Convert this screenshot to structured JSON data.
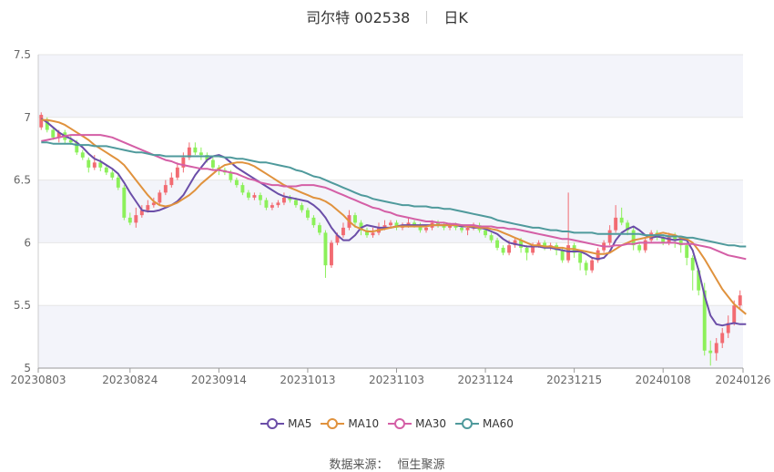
{
  "title": {
    "name": "司尔特 002538",
    "period": "日K"
  },
  "source": {
    "label": "数据来源：",
    "value": "恒生聚源"
  },
  "colors": {
    "up": "#f26b72",
    "down": "#8cf05a",
    "ma5": "#6b4ea8",
    "ma10": "#e0923d",
    "ma30": "#d45fa6",
    "ma60": "#4f9a9c",
    "band": "#f3f4fa",
    "grid": "#e6e6e6",
    "axis": "#666666"
  },
  "chart_data": {
    "type": "candlestick",
    "y_axis": {
      "min": 5,
      "max": 7.5,
      "ticks": [
        5,
        5.5,
        6,
        6.5,
        7,
        7.5
      ],
      "tick_labels": [
        "5",
        "5.5",
        "6",
        "6.5",
        "7",
        "7.5"
      ]
    },
    "x_axis": {
      "tick_labels": [
        "20230803",
        "20230824",
        "20230914",
        "20231013",
        "20231103",
        "20231124",
        "20231215",
        "20240108",
        "20240126"
      ],
      "tick_index": [
        0,
        15,
        30,
        45,
        60,
        75,
        90,
        105,
        119
      ]
    },
    "grid": true,
    "candles": [
      [
        6.92,
        7.02,
        7.04,
        6.9
      ],
      [
        6.98,
        6.9,
        7.0,
        6.88
      ],
      [
        6.9,
        6.84,
        6.92,
        6.82
      ],
      [
        6.84,
        6.88,
        6.9,
        6.8
      ],
      [
        6.88,
        6.82,
        6.9,
        6.79
      ],
      [
        6.82,
        6.8,
        6.86,
        6.78
      ],
      [
        6.8,
        6.72,
        6.82,
        6.7
      ],
      [
        6.72,
        6.68,
        6.74,
        6.66
      ],
      [
        6.66,
        6.6,
        6.68,
        6.56
      ],
      [
        6.6,
        6.64,
        6.7,
        6.58
      ],
      [
        6.64,
        6.6,
        6.67,
        6.57
      ],
      [
        6.6,
        6.56,
        6.62,
        6.54
      ],
      [
        6.56,
        6.52,
        6.58,
        6.5
      ],
      [
        6.52,
        6.44,
        6.54,
        6.42
      ],
      [
        6.44,
        6.2,
        6.46,
        6.18
      ],
      [
        6.2,
        6.16,
        6.24,
        6.14
      ],
      [
        6.16,
        6.22,
        6.28,
        6.12
      ],
      [
        6.22,
        6.26,
        6.3,
        6.2
      ],
      [
        6.26,
        6.3,
        6.34,
        6.24
      ],
      [
        6.3,
        6.32,
        6.36,
        6.28
      ],
      [
        6.32,
        6.4,
        6.42,
        6.3
      ],
      [
        6.4,
        6.46,
        6.5,
        6.38
      ],
      [
        6.46,
        6.52,
        6.56,
        6.44
      ],
      [
        6.52,
        6.6,
        6.64,
        6.5
      ],
      [
        6.6,
        6.68,
        6.72,
        6.56
      ],
      [
        6.68,
        6.76,
        6.8,
        6.66
      ],
      [
        6.76,
        6.72,
        6.8,
        6.7
      ],
      [
        6.72,
        6.7,
        6.76,
        6.66
      ],
      [
        6.7,
        6.66,
        6.72,
        6.64
      ],
      [
        6.66,
        6.6,
        6.68,
        6.58
      ],
      [
        6.6,
        6.58,
        6.62,
        6.54
      ],
      [
        6.58,
        6.56,
        6.6,
        6.54
      ],
      [
        6.56,
        6.5,
        6.58,
        6.48
      ],
      [
        6.5,
        6.46,
        6.52,
        6.44
      ],
      [
        6.46,
        6.4,
        6.48,
        6.38
      ],
      [
        6.4,
        6.36,
        6.42,
        6.34
      ],
      [
        6.36,
        6.38,
        6.4,
        6.34
      ],
      [
        6.38,
        6.34,
        6.4,
        6.3
      ],
      [
        6.34,
        6.28,
        6.36,
        6.26
      ],
      [
        6.28,
        6.3,
        6.32,
        6.26
      ],
      [
        6.3,
        6.32,
        6.34,
        6.28
      ],
      [
        6.32,
        6.36,
        6.4,
        6.3
      ],
      [
        6.36,
        6.34,
        6.38,
        6.32
      ],
      [
        6.34,
        6.3,
        6.36,
        6.28
      ],
      [
        6.3,
        6.26,
        6.32,
        6.24
      ],
      [
        6.26,
        6.2,
        6.28,
        6.18
      ],
      [
        6.2,
        6.14,
        6.22,
        6.12
      ],
      [
        6.14,
        6.08,
        6.16,
        6.06
      ],
      [
        6.08,
        5.82,
        6.1,
        5.72
      ],
      [
        5.82,
        6.0,
        6.02,
        5.8
      ],
      [
        6.0,
        6.06,
        6.08,
        5.98
      ],
      [
        6.06,
        6.12,
        6.16,
        6.04
      ],
      [
        6.12,
        6.22,
        6.26,
        6.1
      ],
      [
        6.22,
        6.16,
        6.24,
        6.12
      ],
      [
        6.16,
        6.1,
        6.18,
        6.06
      ],
      [
        6.1,
        6.06,
        6.12,
        6.04
      ],
      [
        6.06,
        6.08,
        6.12,
        6.04
      ],
      [
        6.08,
        6.12,
        6.16,
        6.06
      ],
      [
        6.12,
        6.14,
        6.18,
        6.1
      ],
      [
        6.14,
        6.16,
        6.18,
        6.12
      ],
      [
        6.16,
        6.12,
        6.18,
        6.1
      ],
      [
        6.12,
        6.14,
        6.16,
        6.1
      ],
      [
        6.14,
        6.16,
        6.2,
        6.12
      ],
      [
        6.16,
        6.14,
        6.18,
        6.12
      ],
      [
        6.14,
        6.1,
        6.16,
        6.08
      ],
      [
        6.1,
        6.12,
        6.14,
        6.08
      ],
      [
        6.12,
        6.16,
        6.18,
        6.1
      ],
      [
        6.16,
        6.14,
        6.18,
        6.12
      ],
      [
        6.14,
        6.12,
        6.16,
        6.1
      ],
      [
        6.12,
        6.14,
        6.16,
        6.1
      ],
      [
        6.14,
        6.12,
        6.16,
        6.1
      ],
      [
        6.12,
        6.1,
        6.14,
        6.08
      ],
      [
        6.1,
        6.12,
        6.14,
        6.06
      ],
      [
        6.12,
        6.14,
        6.16,
        6.1
      ],
      [
        6.14,
        6.1,
        6.16,
        6.08
      ],
      [
        6.1,
        6.06,
        6.12,
        6.04
      ],
      [
        6.06,
        6.02,
        6.08,
        6.0
      ],
      [
        6.02,
        5.96,
        6.04,
        5.94
      ],
      [
        5.96,
        5.92,
        5.98,
        5.9
      ],
      [
        5.92,
        5.98,
        6.02,
        5.9
      ],
      [
        5.98,
        6.02,
        6.04,
        5.96
      ],
      [
        6.02,
        5.96,
        6.04,
        5.92
      ],
      [
        5.96,
        5.92,
        5.98,
        5.86
      ],
      [
        5.92,
        5.98,
        6.0,
        5.9
      ],
      [
        5.98,
        6.0,
        6.02,
        5.96
      ],
      [
        6.0,
        5.96,
        6.02,
        5.94
      ],
      [
        5.96,
        5.98,
        6.0,
        5.94
      ],
      [
        5.98,
        5.94,
        6.0,
        5.9
      ],
      [
        5.94,
        5.86,
        5.96,
        5.84
      ],
      [
        5.86,
        5.98,
        6.4,
        5.84
      ],
      [
        5.98,
        5.92,
        6.0,
        5.88
      ],
      [
        5.92,
        5.84,
        5.94,
        5.78
      ],
      [
        5.84,
        5.78,
        5.86,
        5.74
      ],
      [
        5.78,
        5.86,
        5.88,
        5.76
      ],
      [
        5.86,
        5.94,
        5.96,
        5.84
      ],
      [
        5.94,
        6.0,
        6.02,
        5.92
      ],
      [
        6.0,
        6.1,
        6.14,
        5.98
      ],
      [
        6.1,
        6.2,
        6.3,
        6.08
      ],
      [
        6.2,
        6.16,
        6.28,
        6.14
      ],
      [
        6.16,
        6.1,
        6.18,
        6.06
      ],
      [
        6.1,
        5.98,
        6.12,
        5.94
      ],
      [
        5.98,
        5.94,
        6.0,
        5.92
      ],
      [
        5.94,
        6.02,
        6.04,
        5.92
      ],
      [
        6.02,
        6.08,
        6.1,
        6.0
      ],
      [
        6.08,
        6.04,
        6.1,
        6.02
      ],
      [
        6.04,
        6.0,
        6.06,
        5.98
      ],
      [
        6.0,
        6.06,
        6.08,
        5.98
      ],
      [
        6.06,
        6.02,
        6.08,
        5.96
      ],
      [
        6.02,
        5.98,
        6.04,
        5.92
      ],
      [
        5.98,
        5.88,
        6.0,
        5.82
      ],
      [
        5.88,
        5.78,
        5.9,
        5.62
      ],
      [
        5.78,
        5.62,
        5.8,
        5.58
      ],
      [
        5.62,
        5.14,
        5.68,
        5.1
      ],
      [
        5.14,
        5.12,
        5.22,
        5.02
      ],
      [
        5.12,
        5.2,
        5.24,
        5.06
      ],
      [
        5.2,
        5.28,
        5.32,
        5.16
      ],
      [
        5.28,
        5.36,
        5.42,
        5.24
      ],
      [
        5.36,
        5.5,
        5.54,
        5.34
      ],
      [
        5.5,
        5.58,
        5.62,
        5.48
      ]
    ],
    "series": [
      {
        "name": "MA5",
        "values": [
          6.99,
          6.96,
          6.92,
          6.88,
          6.85,
          6.83,
          6.8,
          6.76,
          6.71,
          6.67,
          6.65,
          6.62,
          6.59,
          6.55,
          6.48,
          6.4,
          6.33,
          6.26,
          6.25,
          6.25,
          6.26,
          6.28,
          6.3,
          6.33,
          6.38,
          6.46,
          6.54,
          6.6,
          6.66,
          6.69,
          6.7,
          6.68,
          6.64,
          6.6,
          6.57,
          6.54,
          6.51,
          6.48,
          6.45,
          6.42,
          6.39,
          6.37,
          6.36,
          6.35,
          6.34,
          6.33,
          6.3,
          6.26,
          6.2,
          6.12,
          6.06,
          6.02,
          6.02,
          6.06,
          6.12,
          6.14,
          6.13,
          6.12,
          6.12,
          6.12,
          6.13,
          6.14,
          6.14,
          6.14,
          6.14,
          6.14,
          6.14,
          6.14,
          6.14,
          6.14,
          6.14,
          6.13,
          6.13,
          6.12,
          6.12,
          6.11,
          6.09,
          6.07,
          6.03,
          6.0,
          5.99,
          5.98,
          5.97,
          5.97,
          5.97,
          5.96,
          5.96,
          5.95,
          5.94,
          5.93,
          5.93,
          5.93,
          5.91,
          5.88,
          5.87,
          5.88,
          5.93,
          6.02,
          6.08,
          6.11,
          6.13,
          6.1,
          6.06,
          6.04,
          6.05,
          6.04,
          6.03,
          6.02,
          6.03,
          6.02,
          5.94,
          5.78,
          5.58,
          5.42,
          5.35,
          5.34,
          5.35,
          5.36,
          5.35,
          5.35
        ]
      },
      {
        "name": "MA10",
        "values": [
          6.98,
          6.98,
          6.97,
          6.96,
          6.94,
          6.91,
          6.88,
          6.85,
          6.82,
          6.78,
          6.75,
          6.72,
          6.69,
          6.66,
          6.62,
          6.56,
          6.5,
          6.44,
          6.38,
          6.33,
          6.3,
          6.29,
          6.3,
          6.32,
          6.35,
          6.38,
          6.42,
          6.47,
          6.51,
          6.55,
          6.59,
          6.62,
          6.63,
          6.64,
          6.64,
          6.63,
          6.61,
          6.58,
          6.55,
          6.52,
          6.49,
          6.46,
          6.44,
          6.42,
          6.4,
          6.38,
          6.36,
          6.35,
          6.33,
          6.3,
          6.26,
          6.22,
          6.17,
          6.13,
          6.11,
          6.09,
          6.09,
          6.1,
          6.11,
          6.12,
          6.13,
          6.13,
          6.13,
          6.13,
          6.13,
          6.13,
          6.14,
          6.14,
          6.14,
          6.14,
          6.14,
          6.14,
          6.13,
          6.13,
          6.12,
          6.12,
          6.11,
          6.1,
          6.08,
          6.06,
          6.04,
          6.02,
          6.0,
          5.98,
          5.98,
          5.97,
          5.97,
          5.96,
          5.96,
          5.95,
          5.95,
          5.94,
          5.93,
          5.92,
          5.91,
          5.91,
          5.92,
          5.95,
          5.98,
          6.0,
          6.02,
          6.03,
          6.04,
          6.05,
          6.07,
          6.08,
          6.07,
          6.06,
          6.04,
          6.03,
          6.0,
          5.94,
          5.87,
          5.79,
          5.71,
          5.63,
          5.57,
          5.51,
          5.47,
          5.43
        ]
      },
      {
        "name": "MA30",
        "values": [
          6.81,
          6.82,
          6.83,
          6.84,
          6.85,
          6.86,
          6.86,
          6.86,
          6.86,
          6.86,
          6.86,
          6.85,
          6.84,
          6.82,
          6.8,
          6.78,
          6.76,
          6.74,
          6.72,
          6.7,
          6.68,
          6.66,
          6.65,
          6.63,
          6.62,
          6.61,
          6.6,
          6.59,
          6.59,
          6.58,
          6.58,
          6.57,
          6.56,
          6.55,
          6.53,
          6.51,
          6.5,
          6.48,
          6.47,
          6.46,
          6.46,
          6.45,
          6.45,
          6.45,
          6.46,
          6.46,
          6.46,
          6.45,
          6.44,
          6.42,
          6.4,
          6.38,
          6.36,
          6.34,
          6.32,
          6.3,
          6.28,
          6.27,
          6.25,
          6.24,
          6.22,
          6.21,
          6.2,
          6.19,
          6.18,
          6.17,
          6.17,
          6.16,
          6.16,
          6.15,
          6.15,
          6.14,
          6.14,
          6.14,
          6.13,
          6.13,
          6.13,
          6.12,
          6.12,
          6.11,
          6.11,
          6.1,
          6.09,
          6.08,
          6.07,
          6.06,
          6.05,
          6.04,
          6.03,
          6.03,
          6.02,
          6.01,
          6.0,
          5.99,
          5.98,
          5.97,
          5.97,
          5.98,
          5.98,
          5.99,
          5.99,
          6.0,
          6.0,
          6.0,
          6.0,
          6.0,
          6.0,
          6.0,
          5.99,
          5.99,
          5.99,
          5.98,
          5.97,
          5.96,
          5.94,
          5.92,
          5.9,
          5.89,
          5.88,
          5.87
        ]
      },
      {
        "name": "MA60",
        "values": [
          6.8,
          6.8,
          6.79,
          6.79,
          6.79,
          6.79,
          6.78,
          6.78,
          6.78,
          6.77,
          6.77,
          6.77,
          6.76,
          6.75,
          6.74,
          6.73,
          6.72,
          6.72,
          6.71,
          6.7,
          6.7,
          6.69,
          6.69,
          6.69,
          6.69,
          6.69,
          6.69,
          6.69,
          6.69,
          6.69,
          6.69,
          6.68,
          6.68,
          6.67,
          6.67,
          6.66,
          6.65,
          6.64,
          6.64,
          6.63,
          6.62,
          6.61,
          6.6,
          6.58,
          6.57,
          6.55,
          6.53,
          6.52,
          6.5,
          6.48,
          6.46,
          6.44,
          6.42,
          6.4,
          6.38,
          6.37,
          6.35,
          6.34,
          6.33,
          6.32,
          6.31,
          6.3,
          6.3,
          6.29,
          6.29,
          6.29,
          6.28,
          6.28,
          6.27,
          6.27,
          6.26,
          6.25,
          6.24,
          6.23,
          6.22,
          6.21,
          6.2,
          6.18,
          6.17,
          6.16,
          6.15,
          6.14,
          6.13,
          6.12,
          6.12,
          6.11,
          6.1,
          6.1,
          6.09,
          6.09,
          6.08,
          6.08,
          6.08,
          6.08,
          6.07,
          6.07,
          6.07,
          6.07,
          6.07,
          6.07,
          6.07,
          6.07,
          6.06,
          6.06,
          6.06,
          6.06,
          6.05,
          6.05,
          6.05,
          6.04,
          6.04,
          6.03,
          6.02,
          6.01,
          6.0,
          5.99,
          5.98,
          5.98,
          5.97,
          5.97
        ]
      }
    ]
  }
}
